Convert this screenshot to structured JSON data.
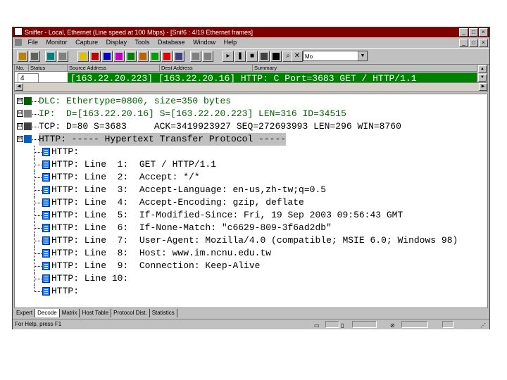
{
  "window": {
    "title": "Sniffer - Local, Ethernet (Line speed at 100 Mbps) - [Snif6 : 4/19 Ethernet frames]"
  },
  "menu": {
    "items": [
      "File",
      "Monitor",
      "Capture",
      "Display",
      "Tools",
      "Database",
      "Window",
      "Help"
    ]
  },
  "toolbar": {
    "combo_value": "Mo"
  },
  "summary": {
    "columns": [
      "No.",
      "Status",
      "Source Address",
      "Dest Address",
      "Summary"
    ],
    "row": {
      "no": "4",
      "source": "[163.22.20.223]",
      "dest": "[163.22.20.16]",
      "summary": "HTTP: C Port=3683 GET / HTTP/1.1"
    }
  },
  "detail": {
    "layers": [
      {
        "text": "DLC: Ethertype=0800, size=350 bytes",
        "expander": "⊟",
        "color": "#006000"
      },
      {
        "text": "IP:  D=[163.22.20.16] S=[163.22.20.223] LEN=316 ID=34515",
        "expander": "⊟",
        "color": "#006000"
      },
      {
        "text": "TCP: D=80 S=3683     ACK=3419923927 SEQ=272693993 LEN=296 WIN=8760",
        "expander": "⊟",
        "color": "#000000"
      },
      {
        "text": "HTTP: ----- Hypertext Transfer Protocol -----",
        "expander": "⊟",
        "color": "#000000"
      }
    ],
    "http_lines": [
      "HTTP:",
      "HTTP: Line  1:  GET / HTTP/1.1",
      "HTTP: Line  2:  Accept: */*",
      "HTTP: Line  3:  Accept-Language: en-us,zh-tw;q=0.5",
      "HTTP: Line  4:  Accept-Encoding: gzip, deflate",
      "HTTP: Line  5:  If-Modified-Since: Fri, 19 Sep 2003 09:56:43 GMT",
      "HTTP: Line  6:  If-None-Match: \"c6629-809-3f6ad2db\"",
      "HTTP: Line  7:  User-Agent: Mozilla/4.0 (compatible; MSIE 6.0; Windows 98)",
      "HTTP: Line  8:  Host: www.im.ncnu.edu.tw",
      "HTTP: Line  9:  Connection: Keep-Alive",
      "HTTP: Line 10:",
      "HTTP:"
    ]
  },
  "tabs": {
    "items": [
      "Expert",
      "Decode",
      "Matrix",
      "Host Table",
      "Protocol Dist.",
      "Statistics"
    ],
    "active": "Decode"
  },
  "status": {
    "text": "For Help, press F1"
  },
  "colors": {
    "title_bg": "#800000",
    "selection_bg": "#008000",
    "layer_green": "#006000",
    "chrome": "#c0c0c0"
  }
}
